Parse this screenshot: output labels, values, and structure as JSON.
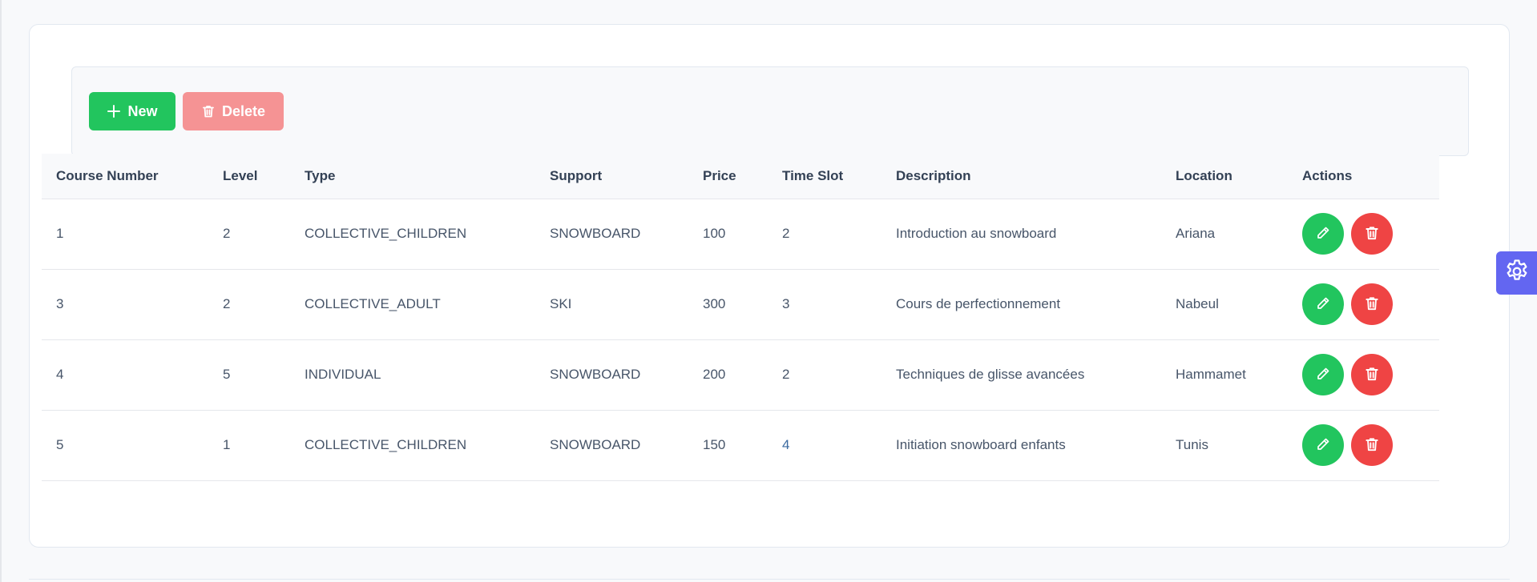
{
  "toolbar": {
    "new_label": "New",
    "delete_label": "Delete",
    "new_color": "#22c55e",
    "delete_color": "#f59394"
  },
  "table": {
    "columns": [
      "Course Number",
      "Level",
      "Type",
      "Support",
      "Price",
      "Time Slot",
      "Description",
      "Location",
      "Actions"
    ],
    "rows": [
      {
        "course_number": "1",
        "level": "2",
        "type": "COLLECTIVE_CHILDREN",
        "support": "SNOWBOARD",
        "price": "100",
        "time_slot": "2",
        "description": "Introduction au snowboard",
        "location": "Ariana"
      },
      {
        "course_number": "3",
        "level": "2",
        "type": "COLLECTIVE_ADULT",
        "support": "SKI",
        "price": "300",
        "time_slot": "3",
        "description": "Cours de perfectionnement",
        "location": "Nabeul"
      },
      {
        "course_number": "4",
        "level": "5",
        "type": "INDIVIDUAL",
        "support": "SNOWBOARD",
        "price": "200",
        "time_slot": "2",
        "description": "Techniques de glisse avancées",
        "location": "Hammamet"
      },
      {
        "course_number": "5",
        "level": "1",
        "type": "COLLECTIVE_CHILDREN",
        "support": "SNOWBOARD",
        "price": "150",
        "time_slot": "4",
        "description": "Initiation snowboard enfants",
        "location": "Tunis"
      }
    ]
  },
  "icons": {
    "new": "plus-icon",
    "delete": "trash-icon",
    "edit": "pencil-icon",
    "row_delete": "trash-icon",
    "settings": "gear-icon"
  },
  "colors": {
    "accent_green": "#22c55e",
    "danger_red": "#ef4444",
    "settings_indigo": "#6366f1"
  }
}
